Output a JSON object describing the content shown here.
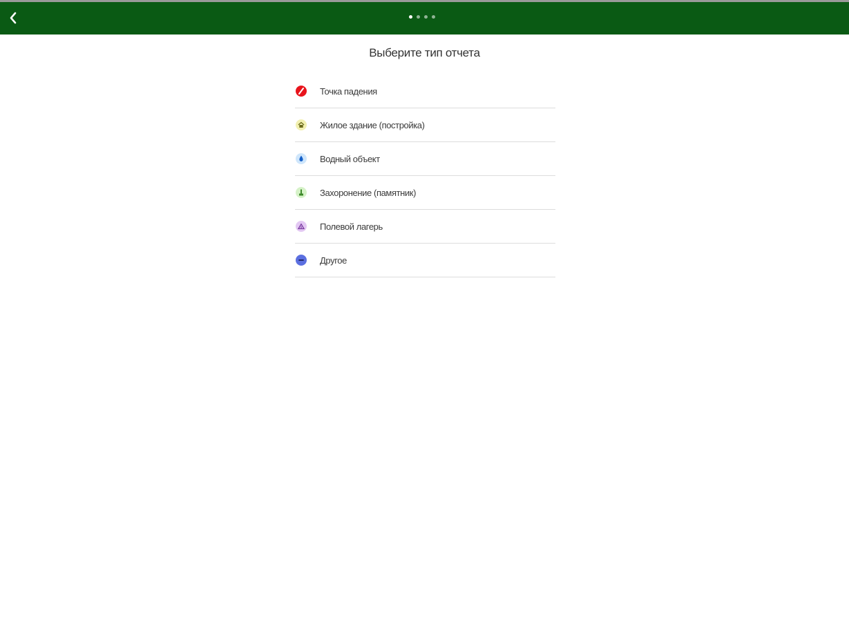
{
  "header": {
    "back_icon": "chevron-left-icon",
    "pager": {
      "count": 4,
      "active_index": 0
    },
    "background_color": "#0a5a14"
  },
  "main": {
    "title": "Выберите тип отчета",
    "items": [
      {
        "label": "Точка падения",
        "icon": "crash-point-icon",
        "color": "#e8141c"
      },
      {
        "label": "Жилое здание (постройка)",
        "icon": "house-icon",
        "color": "#f2f0b0"
      },
      {
        "label": "Водный объект",
        "icon": "water-drop-icon",
        "color": "#cfe6fb"
      },
      {
        "label": "Захоронение (памятник)",
        "icon": "monument-icon",
        "color": "#d6f2c8"
      },
      {
        "label": "Полевой лагерь",
        "icon": "tent-icon",
        "color": "#e3c8f3"
      },
      {
        "label": "Другое",
        "icon": "minus-icon",
        "color": "#5b6fe0"
      }
    ]
  }
}
